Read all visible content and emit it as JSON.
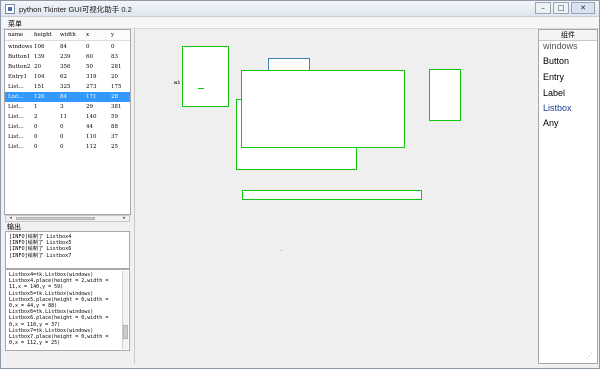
{
  "window": {
    "title": "python Tkinter GUI可视化助手 0.2",
    "controls": {
      "minimize": "–",
      "maximize": "□",
      "close": "✕"
    }
  },
  "menu": {
    "item": "菜单"
  },
  "table": {
    "columns": [
      "name",
      "height",
      "width",
      "x",
      "y"
    ],
    "rows": [
      [
        "windows",
        "106",
        "84",
        "0",
        "0"
      ],
      [
        "Button1",
        "139",
        "239",
        "60",
        "83"
      ],
      [
        "Button2",
        "20",
        "356",
        "50",
        "281"
      ],
      [
        "Entry1",
        "104",
        "62",
        "319",
        "20"
      ],
      [
        "List...",
        "151",
        "325",
        "273",
        "175"
      ],
      [
        "List...",
        "126",
        "84",
        "171",
        "28"
      ],
      [
        "List...",
        "1",
        "3",
        "29",
        "381"
      ],
      [
        "List...",
        "2",
        "11",
        "140",
        "59"
      ],
      [
        "List...",
        "0",
        "0",
        "44",
        "88"
      ],
      [
        "List...",
        "0",
        "0",
        "110",
        "37"
      ],
      [
        "List...",
        "0",
        "0",
        "112",
        "25"
      ]
    ],
    "selected_index": 5
  },
  "output": {
    "label": "输出",
    "lines": [
      "[INFO]绘制了 Listbox4",
      "[INFO]绘制了 Listbox5",
      "[INFO]绘制了 Listbox6",
      "[INFO]绘制了 Listbox7"
    ]
  },
  "code": {
    "lines": [
      "Listbox4=tk.Listbox(windows)",
      "Listbox4.place(height = 2,width =",
      "11,x = 140,y = 59)",
      "Listbox5=tk.Listbox(windows)",
      "Listbox5.place(height = 0,width =",
      "0,x = 44,y = 88)",
      "Listbox6=tk.Listbox(windows)",
      "Listbox6.place(height = 0,width =",
      "0,x = 110,y = 37)",
      "Listbox7=tk.Listbox(windows)",
      "Listbox7.place(height = 0,width =",
      "0,x = 112,y = 25)"
    ]
  },
  "canvas": {
    "label": "wi"
  },
  "components": {
    "header": "组件",
    "items": [
      "windows",
      "Button",
      "Entry",
      "Label",
      "Listbox",
      "Any"
    ]
  },
  "colors": {
    "selection": "#3399ff",
    "outline_green": "#11c511",
    "outline_blue": "#3d86b8",
    "listbox_link": "#1e3c96",
    "windows_gray": "#555555"
  }
}
